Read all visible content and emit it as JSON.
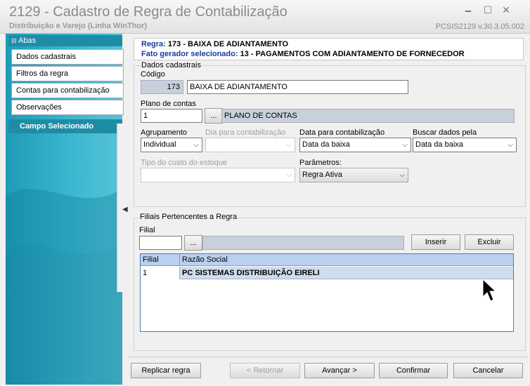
{
  "window": {
    "title": "2129 - Cadastro de Regra de Contabilização",
    "subtitle": "Distribuição e Varejo (Linha WinThor)",
    "version": "PCSIS2129  v.30.3.05.002",
    "minimize_glyph": "🗕",
    "maximize_glyph": "☐",
    "close_glyph": "✕"
  },
  "sidebar": {
    "header": "Abas",
    "items": [
      {
        "label": "Dados cadastrais"
      },
      {
        "label": "Filtros da regra"
      },
      {
        "label": "Contas para contabilização"
      },
      {
        "label": "Observações"
      }
    ],
    "campo_selecionado": "Campo Selecionado",
    "collapse_glyph": "◀"
  },
  "header": {
    "regra_label": "Regra:",
    "regra_value": "173 - BAIXA DE ADIANTAMENTO",
    "fato_label": "Fato gerador selecionado:",
    "fato_value": "13 - PAGAMENTOS COM ADIANTAMENTO DE FORNECEDOR"
  },
  "dados": {
    "legend": "Dados cadastrais",
    "codigo_label": "Código",
    "codigo_value": "173",
    "descricao_value": "BAIXA DE ADIANTAMENTO",
    "plano_label": "Plano de contas",
    "plano_value": "1",
    "plano_button": "...",
    "plano_descricao": "PLANO DE CONTAS",
    "agrupamento_label": "Agrupamento",
    "agrupamento_value": "Individual",
    "dia_label": "Dia para contabilização",
    "dia_value": "",
    "data_label": "Data para contabilização",
    "data_value": "Data da baixa",
    "buscar_label": "Buscar dados pela",
    "buscar_value": "Data da baixa",
    "tipo_custo_label": "Tipo do custo do estoque",
    "tipo_custo_value": "",
    "parametros_label": "Parâmetros:",
    "parametros_value": "Regra Ativa"
  },
  "filiais": {
    "legend": "Filiais Pertencentes a Regra",
    "filial_label": "Filial",
    "filial_value": "",
    "filial_button": "...",
    "inserir": "Inserir",
    "excluir": "Excluir",
    "columns": [
      "Filial",
      "Razão Social"
    ],
    "rows": [
      {
        "filial": "1",
        "razao_social": "PC SISTEMAS DISTRIBUIÇÃO  EIRELI"
      }
    ]
  },
  "footer": {
    "replicar": "Replicar regra",
    "retornar": "< Retornar",
    "avancar": "Avançar >",
    "confirmar": "Confirmar",
    "cancelar": "Cancelar"
  },
  "chevron_glyph": "⌵"
}
